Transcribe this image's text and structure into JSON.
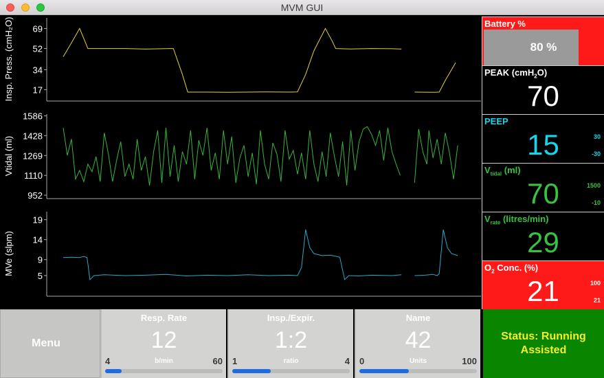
{
  "window": {
    "title": "MVM GUI"
  },
  "colors": {
    "pressure": "#e3d33a",
    "volume": "#39b53c",
    "flow": "#29a9c9",
    "alarm_red": "#ff1a1a",
    "status_green": "#0a8500",
    "status_text": "#f5ef2a",
    "slider_fill": "#1d6ce6"
  },
  "chart_data": [
    {
      "type": "line",
      "ylabel": "Insp. Press. (cmH₂O)",
      "yticks": [
        17,
        34,
        52,
        69
      ],
      "ylim": [
        8,
        78
      ],
      "xlim": [
        0,
        100
      ],
      "grid": false,
      "series": [
        {
          "segments": [
            [
              [
                0,
                45
              ],
              [
                2.2,
                58
              ],
              [
                4.0,
                69
              ],
              [
                5.3,
                58
              ],
              [
                6.0,
                52
              ],
              [
                10,
                52
              ],
              [
                15,
                52
              ],
              [
                20,
                51.5
              ],
              [
                26,
                52
              ],
              [
                26.8,
                52
              ],
              [
                29,
                30
              ],
              [
                30.3,
                15
              ],
              [
                35,
                15
              ],
              [
                40,
                14.8
              ],
              [
                45,
                15
              ],
              [
                50,
                15.2
              ],
              [
                55,
                15
              ],
              [
                57,
                15.2
              ],
              [
                59,
                30
              ],
              [
                61,
                50
              ],
              [
                63.8,
                69
              ],
              [
                65.5,
                58
              ],
              [
                66.3,
                52
              ],
              [
                70,
                51.6
              ],
              [
                75,
                52
              ],
              [
                80,
                51.8
              ],
              [
                82.3,
                51.5
              ]
            ],
            [
              [
                85.5,
                15
              ],
              [
                90,
                14.8
              ],
              [
                91.5,
                15
              ],
              [
                93,
                25
              ],
              [
                95.5,
                40
              ]
            ]
          ]
        }
      ]
    },
    {
      "type": "line",
      "ylabel": "Vtidal (ml)",
      "yticks": [
        952,
        1110,
        1269,
        1428,
        1586
      ],
      "ylim": [
        930,
        1600
      ],
      "xlim": [
        0,
        100
      ],
      "grid": false,
      "series": [
        {
          "segments": [
            [
              [
                0,
                1490
              ],
              [
                1,
                1270
              ],
              [
                2,
                1400
              ],
              [
                3,
                1080
              ],
              [
                4,
                1150
              ],
              [
                5,
                1060
              ],
              [
                6,
                1200
              ],
              [
                7,
                1140
              ],
              [
                8,
                1260
              ],
              [
                9,
                1060
              ],
              [
                10,
                1450
              ],
              [
                11,
                1280
              ],
              [
                12,
                1060
              ],
              [
                13,
                1230
              ],
              [
                14,
                1380
              ],
              [
                15,
                1100
              ],
              [
                16,
                1200
              ],
              [
                17,
                1080
              ],
              [
                18,
                1400
              ],
              [
                19,
                1150
              ],
              [
                20,
                1260
              ],
              [
                21,
                1030
              ],
              [
                22,
                1300
              ],
              [
                23,
                1470
              ],
              [
                24,
                1050
              ],
              [
                25,
                1490
              ],
              [
                26,
                1100
              ],
              [
                27,
                1350
              ],
              [
                28,
                1060
              ],
              [
                29,
                1300
              ],
              [
                30,
                1200
              ],
              [
                31,
                1470
              ],
              [
                32,
                1080
              ],
              [
                33,
                1390
              ],
              [
                34,
                1270
              ],
              [
                35,
                1490
              ],
              [
                36,
                1150
              ],
              [
                37,
                1290
              ],
              [
                38,
                1080
              ],
              [
                39,
                1470
              ],
              [
                40,
                1200
              ],
              [
                41,
                1420
              ],
              [
                42,
                1050
              ],
              [
                43,
                1250
              ],
              [
                44,
                1350
              ],
              [
                45,
                1100
              ],
              [
                46,
                1290
              ],
              [
                47,
                1040
              ],
              [
                48,
                1470
              ],
              [
                49,
                1200
              ],
              [
                50,
                1080
              ],
              [
                51,
                1370
              ],
              [
                52,
                1280
              ],
              [
                53,
                1060
              ],
              [
                54,
                1470
              ],
              [
                55,
                1240
              ],
              [
                56,
                1310
              ],
              [
                57,
                1120
              ],
              [
                58,
                1290
              ],
              [
                59,
                1080
              ],
              [
                60,
                1470
              ],
              [
                61,
                1200
              ],
              [
                62,
                1060
              ],
              [
                63,
                1300
              ],
              [
                64,
                1100
              ],
              [
                65,
                1450
              ],
              [
                66,
                1260
              ],
              [
                67,
                1100
              ],
              [
                68,
                1380
              ],
              [
                69,
                1030
              ],
              [
                70,
                1470
              ],
              [
                71,
                1150
              ],
              [
                72,
                1380
              ],
              [
                73,
                1480
              ],
              [
                74,
                1500
              ],
              [
                75,
                1440
              ],
              [
                76,
                1350
              ],
              [
                77,
                1470
              ],
              [
                78,
                1230
              ],
              [
                79,
                1490
              ],
              [
                80,
                1300
              ],
              [
                81,
                1200
              ],
              [
                82,
                1110
              ]
            ],
            [
              [
                85.5,
                1050
              ],
              [
                86.5,
                1480
              ],
              [
                87.5,
                1300
              ],
              [
                88.5,
                1200
              ],
              [
                89,
                1470
              ],
              [
                90,
                1250
              ],
              [
                91,
                1400
              ],
              [
                92,
                1200
              ],
              [
                93,
                1450
              ],
              [
                94,
                1290
              ],
              [
                95,
                1080
              ],
              [
                96,
                1350
              ]
            ]
          ]
        }
      ]
    },
    {
      "type": "line",
      "ylabel": "MVe (slpm)",
      "yticks": [
        5,
        9,
        14,
        19
      ],
      "ylim": [
        0,
        21
      ],
      "xlim": [
        0,
        100
      ],
      "grid": false,
      "series": [
        {
          "segments": [
            [
              [
                0,
                9.5
              ],
              [
                2,
                9.6
              ],
              [
                4,
                9.5
              ],
              [
                5,
                9.8
              ],
              [
                5.8,
                9.5
              ],
              [
                6.5,
                4
              ],
              [
                7.5,
                5
              ],
              [
                10,
                5.2
              ],
              [
                15,
                5
              ],
              [
                20,
                5.1
              ],
              [
                25,
                5.3
              ],
              [
                30,
                4.9
              ],
              [
                35,
                5.1
              ],
              [
                40,
                5
              ],
              [
                45,
                5.2
              ],
              [
                50,
                5
              ],
              [
                55,
                5.1
              ],
              [
                57,
                5
              ],
              [
                58,
                7
              ],
              [
                59,
                16.5
              ],
              [
                60,
                12
              ],
              [
                61,
                10.5
              ],
              [
                63,
                10
              ],
              [
                65,
                10.1
              ],
              [
                66.5,
                9.8
              ],
              [
                67.3,
                9.6
              ],
              [
                68.5,
                4
              ],
              [
                69.5,
                5
              ],
              [
                72,
                4.9
              ],
              [
                75,
                5.1
              ],
              [
                80,
                5
              ],
              [
                82.3,
                5.2
              ]
            ],
            [
              [
                85.5,
                5
              ],
              [
                88,
                5.1
              ],
              [
                90,
                5.3
              ],
              [
                91,
                5
              ],
              [
                91.5,
                5.5
              ],
              [
                92.5,
                16.5
              ],
              [
                93.5,
                12
              ],
              [
                94.5,
                10.5
              ],
              [
                96,
                10
              ]
            ]
          ]
        }
      ]
    }
  ],
  "monitors": {
    "battery": {
      "label": "Battery %",
      "value": "80 %",
      "fraction": 0.8
    },
    "peak": {
      "label_main": "PEAK (cmH",
      "label_sub": "2",
      "label_end": "O)",
      "value": "70"
    },
    "peep": {
      "label": "PEEP",
      "value": "15",
      "max": "30",
      "min": "-30"
    },
    "vtidal": {
      "label_main": "V",
      "label_sub": "tidal",
      "label_end": " (ml)",
      "value": "70",
      "max": "1500",
      "min": "-10"
    },
    "vrate": {
      "label_main": "V",
      "label_sub": "rate",
      "label_end": " (litres/min)",
      "value": "29"
    },
    "o2": {
      "label_main": "O",
      "label_sub": "2",
      "label_end": " Conc. (%)",
      "value": "21",
      "max": "100",
      "min": "21"
    }
  },
  "controls": {
    "menu": {
      "label": "Menu"
    },
    "resp_rate": {
      "label": "Resp. Rate",
      "value": "12",
      "min": "4",
      "max": "60",
      "unit": "b/min",
      "fraction": 0.14
    },
    "ie": {
      "label": "Insp./Expir.",
      "value": "1:2",
      "min": "1",
      "max": "4",
      "unit": "ratio",
      "fraction": 0.33
    },
    "name": {
      "label": "Name",
      "value": "42",
      "min": "0",
      "max": "100",
      "unit": "Units",
      "fraction": 0.42
    }
  },
  "status": {
    "line1": "Status: Running",
    "line2": "Assisted"
  }
}
